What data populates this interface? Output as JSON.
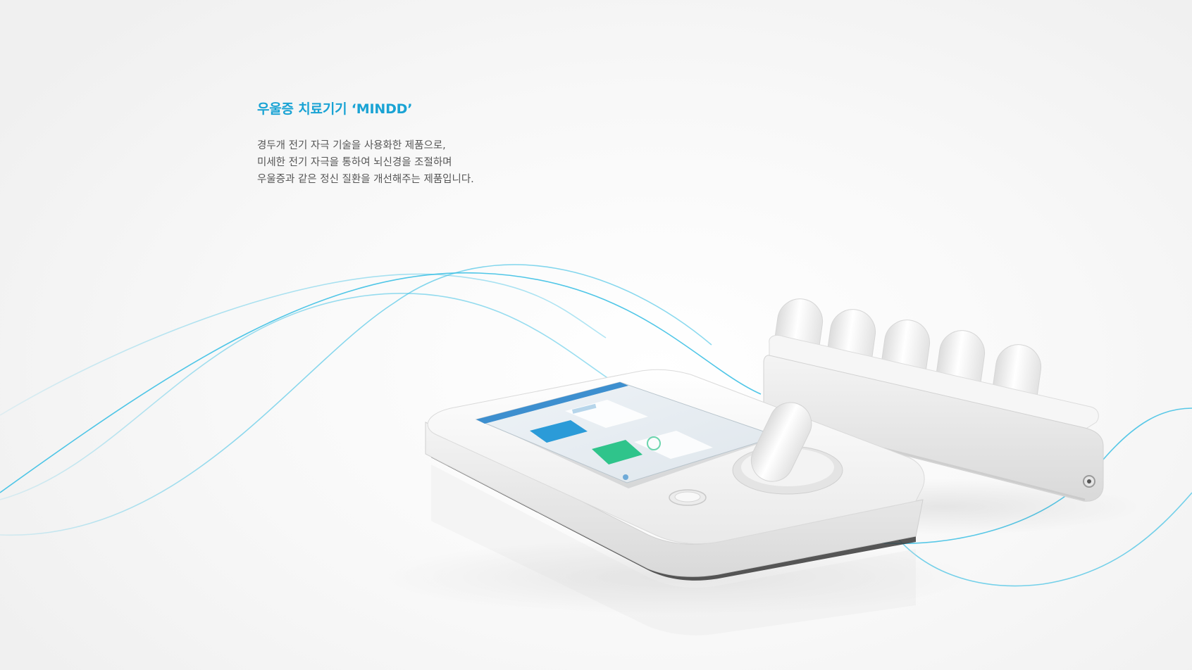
{
  "headline": "우울증 치료기기 ‘MINDD’",
  "description": [
    "경두개 전기 자극 기술을 사용화한 제품으로,",
    "미세한 전기 자극을 통하여 뇌신경을 조절하며",
    "우울증과 같은 정신 질환을 개선해주는 제품입니다."
  ],
  "colors": {
    "accent": "#1aa3d4",
    "wave": "#3cc0e4",
    "device": "#ffffff",
    "screen_header": "#3d8fcf",
    "screen_button_blue": "#2b9bd8",
    "screen_button_green": "#2fc48b"
  },
  "icons": {
    "home_button": "circle-button-icon",
    "charging_port": "port-icon",
    "bluetooth": "bluetooth-icon"
  }
}
